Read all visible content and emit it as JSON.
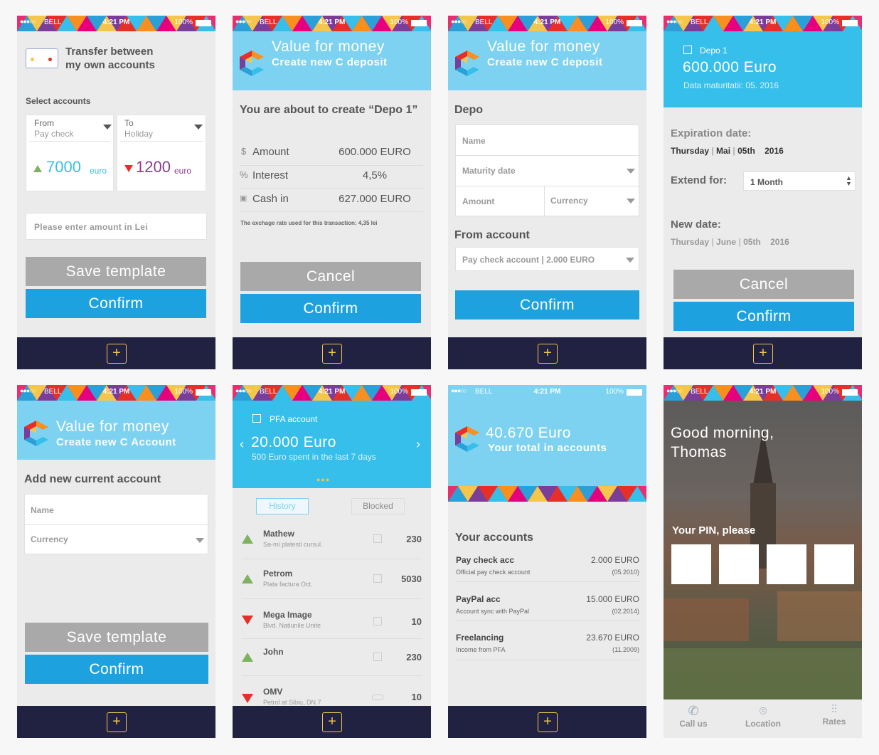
{
  "status": {
    "carrier": "BELL",
    "time": "4:21 PM",
    "battery": "100%"
  },
  "colors": {
    "accent_blue": "#1ea2df",
    "header_blue": "#7dd2f1",
    "nav_dark": "#212142",
    "plus_yellow": "#f4c64c",
    "up_green": "#7db25e",
    "down_red": "#e62f28"
  },
  "screen1": {
    "title_line1": "Transfer between",
    "title_line2": "my own accounts",
    "select_label": "Select accounts",
    "from_label": "From",
    "from_value": "Pay check",
    "to_label": "To",
    "to_value": "Holiday",
    "from_amount": "7000",
    "to_amount": "1200",
    "currency": "euro",
    "amount_placeholder": "Please enter amount in Lei",
    "save_label": "Save template",
    "confirm_label": "Confirm"
  },
  "screen2": {
    "h1": "Value for money",
    "h2": "Create new C deposit",
    "about": "You are about to create “Depo 1”",
    "rows": [
      {
        "icon": "$",
        "label": "Amount",
        "value": "600.000 EURO"
      },
      {
        "icon": "%",
        "label": "Interest",
        "value": "4,5%"
      },
      {
        "icon": "▣",
        "label": "Cash in",
        "value": "627.000 EURO"
      }
    ],
    "note": "The exchage rate used for this transaction: 4,35 lei",
    "cancel_label": "Cancel",
    "confirm_label": "Confirm"
  },
  "screen3": {
    "h1": "Value for money",
    "h2": "Create new C deposit",
    "section": "Depo",
    "name_ph": "Name",
    "maturity_ph": "Maturity date",
    "amount_ph": "Amount",
    "currency_ph": "Currency",
    "from_label": "From account",
    "from_value": "Pay check account | 2.000 EURO",
    "confirm_label": "Confirm"
  },
  "screen4": {
    "depo": "Depo 1",
    "amount": "600.000 Euro",
    "maturity": "Data maturitatii: 05. 2016",
    "exp_label": "Expiration date:",
    "exp_day": "Thursday",
    "exp_month": "Mai",
    "exp_date": "05th",
    "exp_year": "2016",
    "extend_label": "Extend for:",
    "extend_value": "1 Month",
    "new_label": "New date:",
    "new_day": "Thursday",
    "new_month": "June",
    "new_date": "05th",
    "new_year": "2016",
    "cancel_label": "Cancel",
    "confirm_label": "Confirm"
  },
  "screen5": {
    "h1": "Value for money",
    "h2": "Create new C Account",
    "section": "Add new current account",
    "name_ph": "Name",
    "currency_ph": "Currency",
    "save_label": "Save template",
    "confirm_label": "Confirm"
  },
  "screen6": {
    "account": "PFA account",
    "amount": "20.000 Euro",
    "spent": "500 Euro spent in the last 7 days",
    "tab_history": "History",
    "tab_blocked": "Blocked",
    "transactions": [
      {
        "dir": "up",
        "name": "Mathew",
        "desc": "Sa-mi platesti cursul.",
        "value": "230"
      },
      {
        "dir": "up",
        "name": "Petrom",
        "desc": "Plata factura Oct.",
        "value": "5030"
      },
      {
        "dir": "down",
        "name": "Mega Image",
        "desc": "Blvd. Natiunile Unite",
        "value": "10"
      },
      {
        "dir": "up",
        "name": "John",
        "desc": "",
        "value": "230"
      },
      {
        "dir": "down",
        "name": "OMV",
        "desc": "Petrol at Sibiu, DN.7",
        "value": "10"
      }
    ]
  },
  "screen7": {
    "amount": "40.670 Euro",
    "subtitle": "Your total in accounts",
    "section": "Your accounts",
    "accounts": [
      {
        "name": "Pay check acc",
        "desc": "Official pay check account",
        "amount": "2.000 EURO",
        "date": "(05.2010)"
      },
      {
        "name": "PayPal acc",
        "desc": "Account sync with PayPal",
        "amount": "15.000 EURO",
        "date": "(02.2014)"
      },
      {
        "name": "Freelancing",
        "desc": "Income from PFA",
        "amount": "23.670 EURO",
        "date": "(11.2009)"
      }
    ]
  },
  "screen8": {
    "greeting1": "Good morning,",
    "greeting2": "Thomas",
    "pin_label": "Your PIN, please",
    "nav_call": "Call us",
    "nav_location": "Location",
    "nav_rates": "Rates"
  }
}
